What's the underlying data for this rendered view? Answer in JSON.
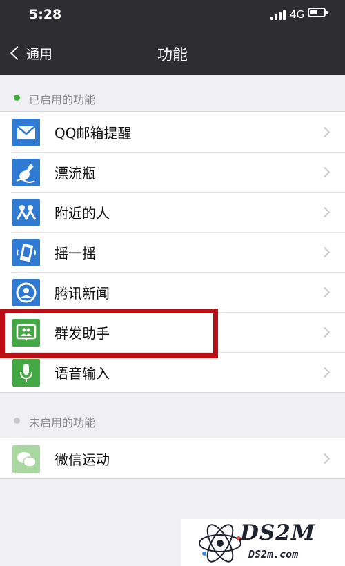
{
  "status_bar": {
    "time": "5:28",
    "network": "4G"
  },
  "nav": {
    "back_label": "通用",
    "title": "功能"
  },
  "sections": [
    {
      "label": "已启用的功能",
      "dot_color": "#3cb035",
      "items": [
        {
          "label": "QQ邮箱提醒",
          "icon": "mail-icon",
          "color": "#2f7bd3"
        },
        {
          "label": "漂流瓶",
          "icon": "bottle-icon",
          "color": "#2f7bd3"
        },
        {
          "label": "附近的人",
          "icon": "people-nearby-icon",
          "color": "#2f7bd3"
        },
        {
          "label": "摇一摇",
          "icon": "shake-icon",
          "color": "#2f7bd3"
        },
        {
          "label": "腾讯新闻",
          "icon": "news-icon",
          "color": "#2f7bd3"
        },
        {
          "label": "群发助手",
          "icon": "broadcast-icon",
          "color": "#43a843"
        },
        {
          "label": "语音输入",
          "icon": "microphone-icon",
          "color": "#43a843"
        }
      ]
    },
    {
      "label": "未启用的功能",
      "dot_color": "#c8c8cc",
      "items": [
        {
          "label": "微信运动",
          "icon": "wechat-sport-icon",
          "color": "#a8d8a0"
        }
      ]
    }
  ],
  "watermark": {
    "brand": "DS2M",
    "url": "DS2m.com"
  }
}
